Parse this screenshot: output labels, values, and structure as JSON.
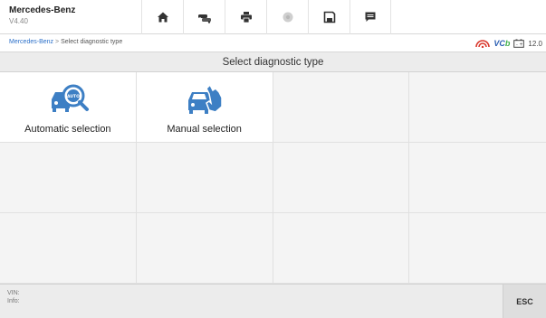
{
  "app": {
    "name": "Mercedes-Benz",
    "version": "V4.40"
  },
  "toolbar": {
    "icons": [
      "home-icon",
      "vehicle-swap-icon",
      "print-icon",
      "record-icon",
      "save-icon",
      "message-icon"
    ]
  },
  "breadcrumb": {
    "root": "Mercedes-Benz",
    "separator": ">",
    "current": "Select diagnostic type"
  },
  "status": {
    "vci_label": "VC",
    "vci_suffix": "b",
    "voltage": "12.0"
  },
  "title": "Select diagnostic type",
  "options": [
    {
      "label": "Automatic selection",
      "icon": "auto-car-icon",
      "badge": "AUTO"
    },
    {
      "label": "Manual selection",
      "icon": "manual-car-icon"
    }
  ],
  "footer": {
    "vin_label": "VIN:",
    "info_label": "Info:",
    "esc_label": "ESC"
  },
  "colors": {
    "accent_blue": "#2b5fb3",
    "icon_blue": "#3d7fc4",
    "link_blue": "#2a6fc9",
    "signal_red": "#d9362b",
    "vci_green": "#3fae49"
  }
}
